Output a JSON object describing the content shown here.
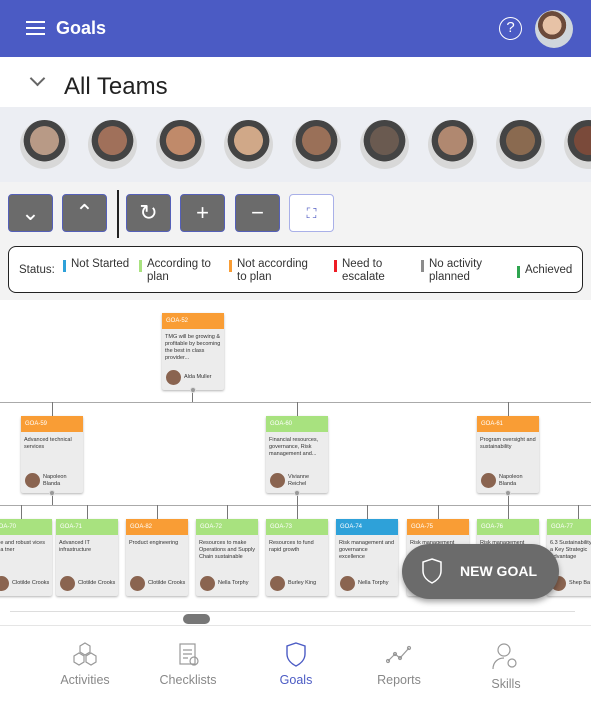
{
  "header": {
    "title": "Goals",
    "help": "?"
  },
  "team": {
    "title": "All Teams"
  },
  "toolbar": {
    "buttons": [
      {
        "name": "collapse-all",
        "glyph": "⌄"
      },
      {
        "name": "expand-all",
        "glyph": "⌃"
      },
      {
        "name": "refresh",
        "glyph": "↻"
      },
      {
        "name": "zoom-in",
        "glyph": "+"
      },
      {
        "name": "zoom-out",
        "glyph": "−"
      },
      {
        "name": "fit-screen",
        "glyph": "⛶"
      }
    ]
  },
  "legend": {
    "label": "Status:",
    "items": [
      {
        "label": "Not Started",
        "color": "#2ea1d9"
      },
      {
        "label": "According to plan",
        "color": "#a8e27f"
      },
      {
        "label": "Not according to plan",
        "color": "#f99d35"
      },
      {
        "label": "Need to escalate",
        "color": "#ee1c25"
      },
      {
        "label": "No activity planned",
        "color": "#8c8c8c"
      },
      {
        "label": "Achieved",
        "color": "#2ea44f"
      }
    ]
  },
  "goals": [
    {
      "id": "GOA-52",
      "status": "#f99d35",
      "text": "TMG will be growing & profitable by becoming the best in class provider...",
      "owner": "Alda Muller"
    },
    {
      "id": "GOA-59",
      "status": "#f99d35",
      "text": "Advanced technical services",
      "owner": "Napoleon Blanda"
    },
    {
      "id": "GOA-60",
      "status": "#a8e27f",
      "text": "Financial resources, governance, Risk management and...",
      "owner": "Vivianne Reichel"
    },
    {
      "id": "GOA-61",
      "status": "#f99d35",
      "text": "Program oversight and sustainability",
      "owner": "Napoleon Blanda"
    },
    {
      "id": "GOA-70",
      "status": "#a8e27f",
      "text": "able and robust vices as a tner",
      "owner": "Clotilde Crooks"
    },
    {
      "id": "GOA-71",
      "status": "#a8e27f",
      "text": "Advanced IT infrastructure",
      "owner": "Clotilde Crooks"
    },
    {
      "id": "GOA-82",
      "status": "#f99d35",
      "text": "Product engineering",
      "owner": "Clotilde Crooks"
    },
    {
      "id": "GOA-72",
      "status": "#a8e27f",
      "text": "Resources to make Operations and Supply Chain sustainable",
      "owner": "Nella Torphy"
    },
    {
      "id": "GOA-73",
      "status": "#a8e27f",
      "text": "Resources to fund rapid growth",
      "owner": "Burley King"
    },
    {
      "id": "GOA-74",
      "status": "#2ea1d9",
      "text": "Risk management and governance excellence",
      "owner": "Nella Torphy"
    },
    {
      "id": "GOA-75",
      "status": "#f99d35",
      "text": "Risk management",
      "owner": ""
    },
    {
      "id": "GOA-76",
      "status": "#a8e27f",
      "text": "Risk management",
      "owner": ""
    },
    {
      "id": "GOA-77",
      "status": "#a8e27f",
      "text": "6.3 Sustainability to be a Key Strategic Advantage",
      "owner": "Shep Ba"
    }
  ],
  "fab": {
    "label": "NEW GOAL"
  },
  "nav": {
    "items": [
      {
        "label": "Activities",
        "active": false
      },
      {
        "label": "Checklists",
        "active": false
      },
      {
        "label": "Goals",
        "active": true
      },
      {
        "label": "Reports",
        "active": false
      },
      {
        "label": "Skills",
        "active": false
      }
    ]
  },
  "colors": {
    "header": "#4b5bc4",
    "accent": "#4b5bc4"
  }
}
